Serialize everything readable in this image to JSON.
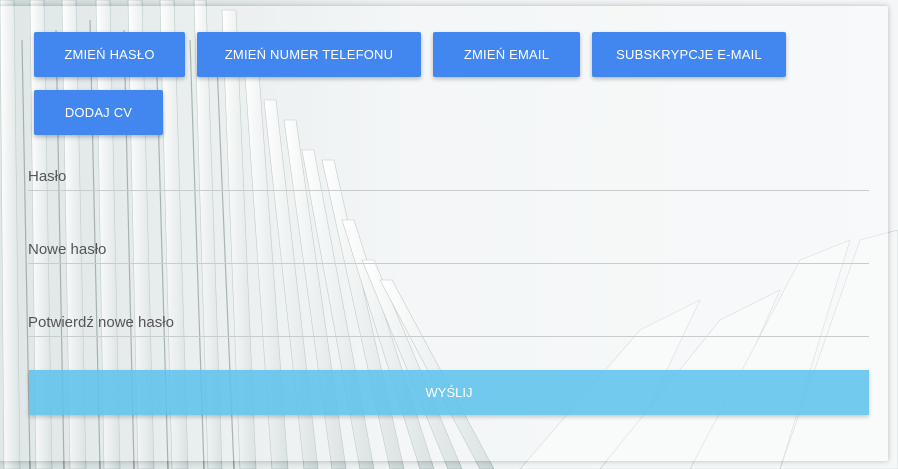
{
  "tabs": {
    "change_password": "ZMIEŃ HASŁO",
    "change_phone": "ZMIEŃ NUMER TELEFONU",
    "change_email": "ZMIEŃ EMAIL",
    "email_subscriptions": "SUBSKRYPCJE E-MAIL",
    "add_cv": "DODAJ CV"
  },
  "form": {
    "password_label": "Hasło",
    "new_password_label": "Nowe hasło",
    "confirm_password_label": "Potwierdź nowe hasło",
    "submit_label": "WYŚLIJ"
  },
  "colors": {
    "tab_button": "#4287f0",
    "submit_button": "#5ec3ec",
    "underline": "#c8cccd"
  }
}
